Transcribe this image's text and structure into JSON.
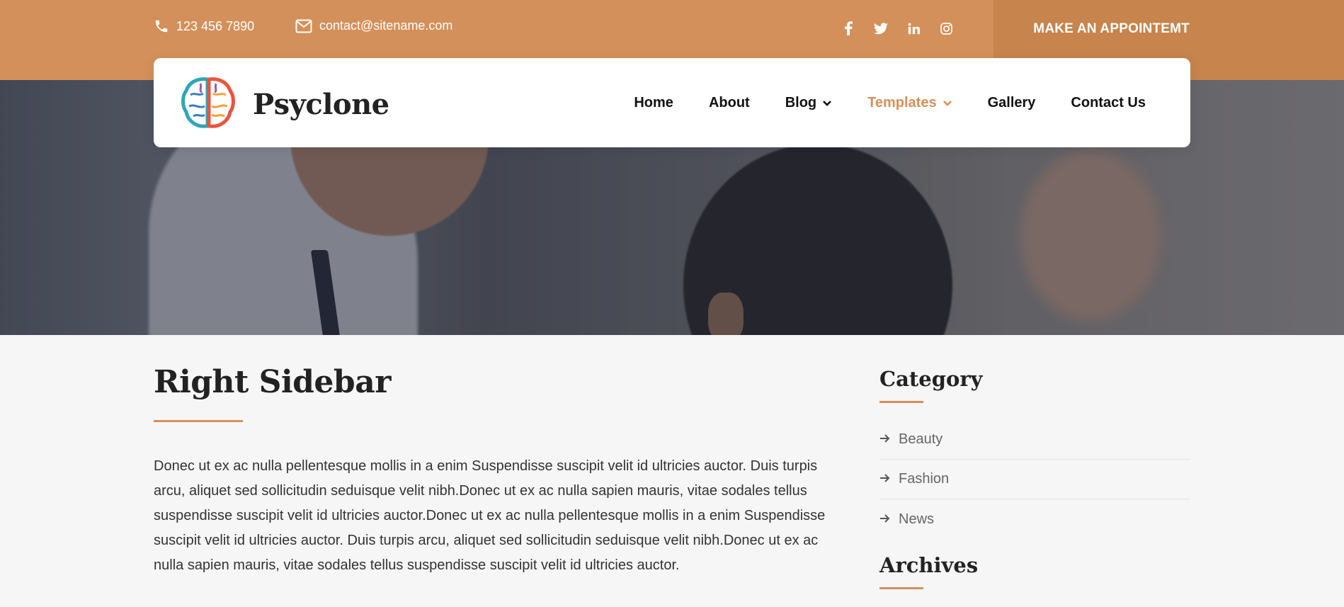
{
  "topbar": {
    "phone": "123 456 7890",
    "email": "contact@sitename.com",
    "socials": [
      "facebook-icon",
      "twitter-icon",
      "linkedin-icon",
      "instagram-icon"
    ],
    "appointment_label": "MAKE AN APPOINTEMT"
  },
  "nav": {
    "brand": "Psyclone",
    "items": [
      {
        "label": "Home",
        "dropdown": false
      },
      {
        "label": "About",
        "dropdown": false
      },
      {
        "label": "Blog",
        "dropdown": true
      },
      {
        "label": "Templates",
        "dropdown": true,
        "active": true
      },
      {
        "label": "Gallery",
        "dropdown": false
      },
      {
        "label": "Contact Us",
        "dropdown": false
      }
    ]
  },
  "main": {
    "title": "Right Sidebar",
    "paragraph": "Donec ut ex ac nulla pellentesque mollis in a enim Suspendisse suscipit velit id ultricies auctor. Duis turpis arcu, aliquet sed sollicitudin seduisque velit nibh.Donec ut ex ac nulla sapien mauris, vitae sodales tellus suspendisse suscipit velit id ultricies auctor.Donec ut ex ac nulla pellentesque mollis in a enim Suspendisse suscipit velit id ultricies auctor. Duis turpis arcu, aliquet sed sollicitudin seduisque velit nibh.Donec ut ex ac nulla sapien mauris, vitae sodales tellus suspendisse suscipit velit id ultricies auctor."
  },
  "sidebar": {
    "category_title": "Category",
    "categories": [
      "Beauty",
      "Fashion",
      "News"
    ],
    "archives_title": "Archives"
  },
  "colors": {
    "accent": "#d4905a",
    "accent_dark": "#c7844c",
    "background": "#f6f6f6"
  }
}
